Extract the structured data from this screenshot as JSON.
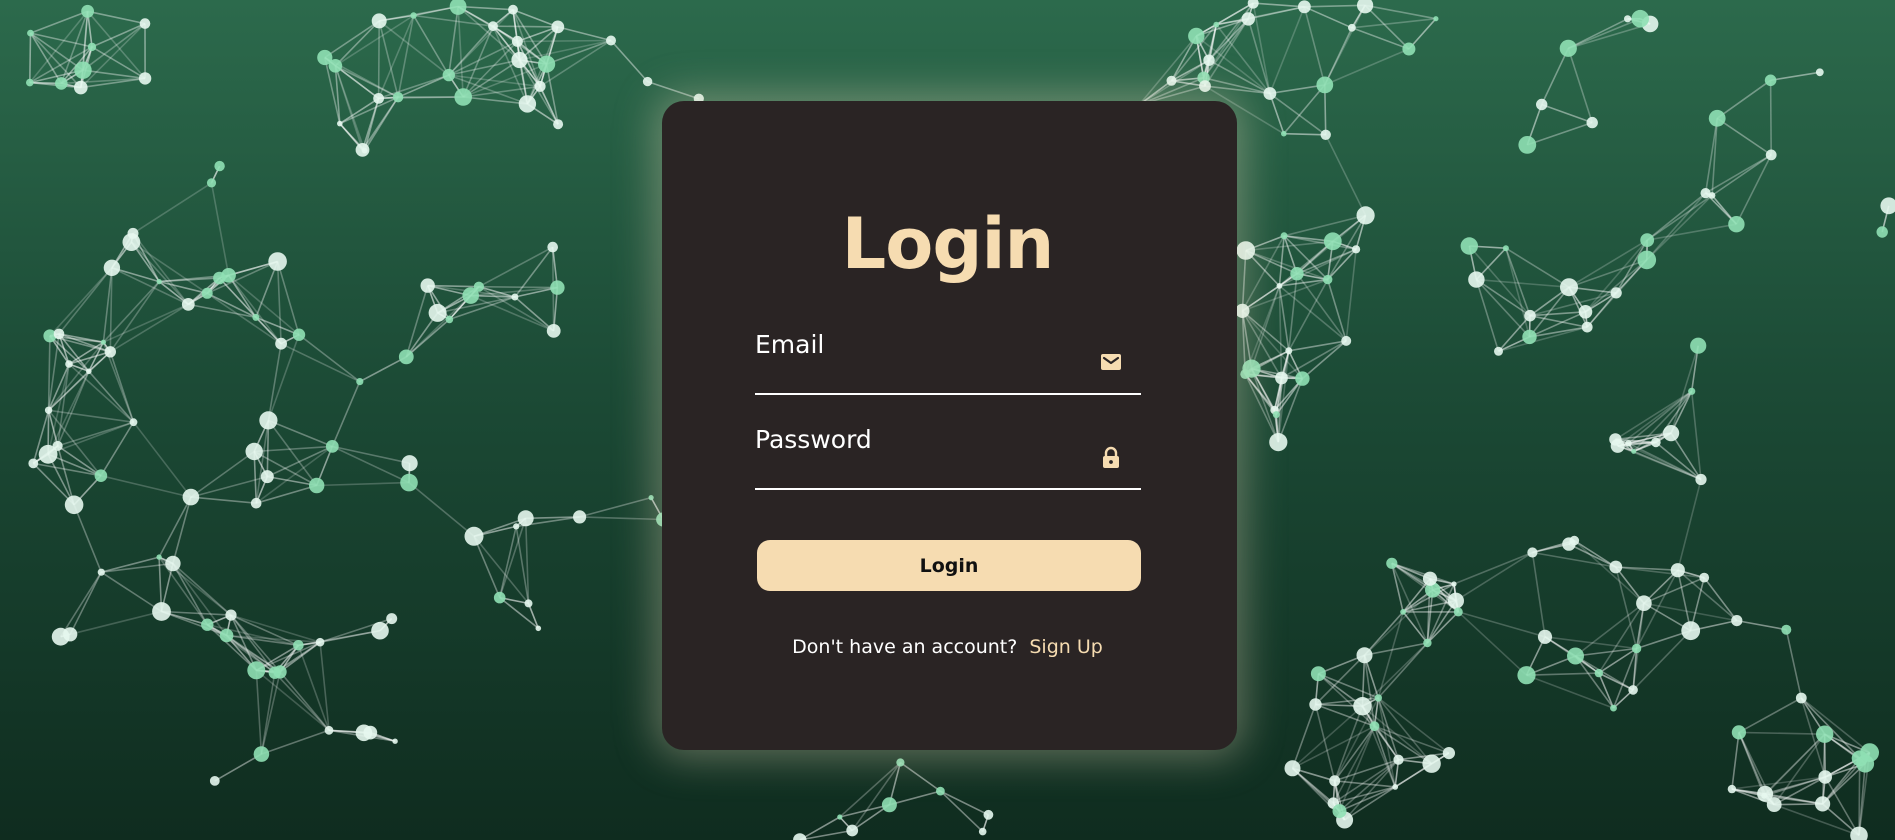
{
  "login": {
    "title": "Login",
    "email": {
      "label": "Email",
      "value": "",
      "icon": "envelope-icon"
    },
    "password": {
      "label": "Password",
      "value": "",
      "icon": "lock-icon"
    },
    "submit_label": "Login",
    "signup_prompt": "Don't have an account?",
    "signup_link": "Sign Up"
  },
  "colors": {
    "accent": "#f6dcb1",
    "card_background": "#2a2424",
    "page_background_top": "#2c6a4c",
    "page_background_bottom": "#0f2c1f",
    "network_node": "#8fe0b4"
  }
}
